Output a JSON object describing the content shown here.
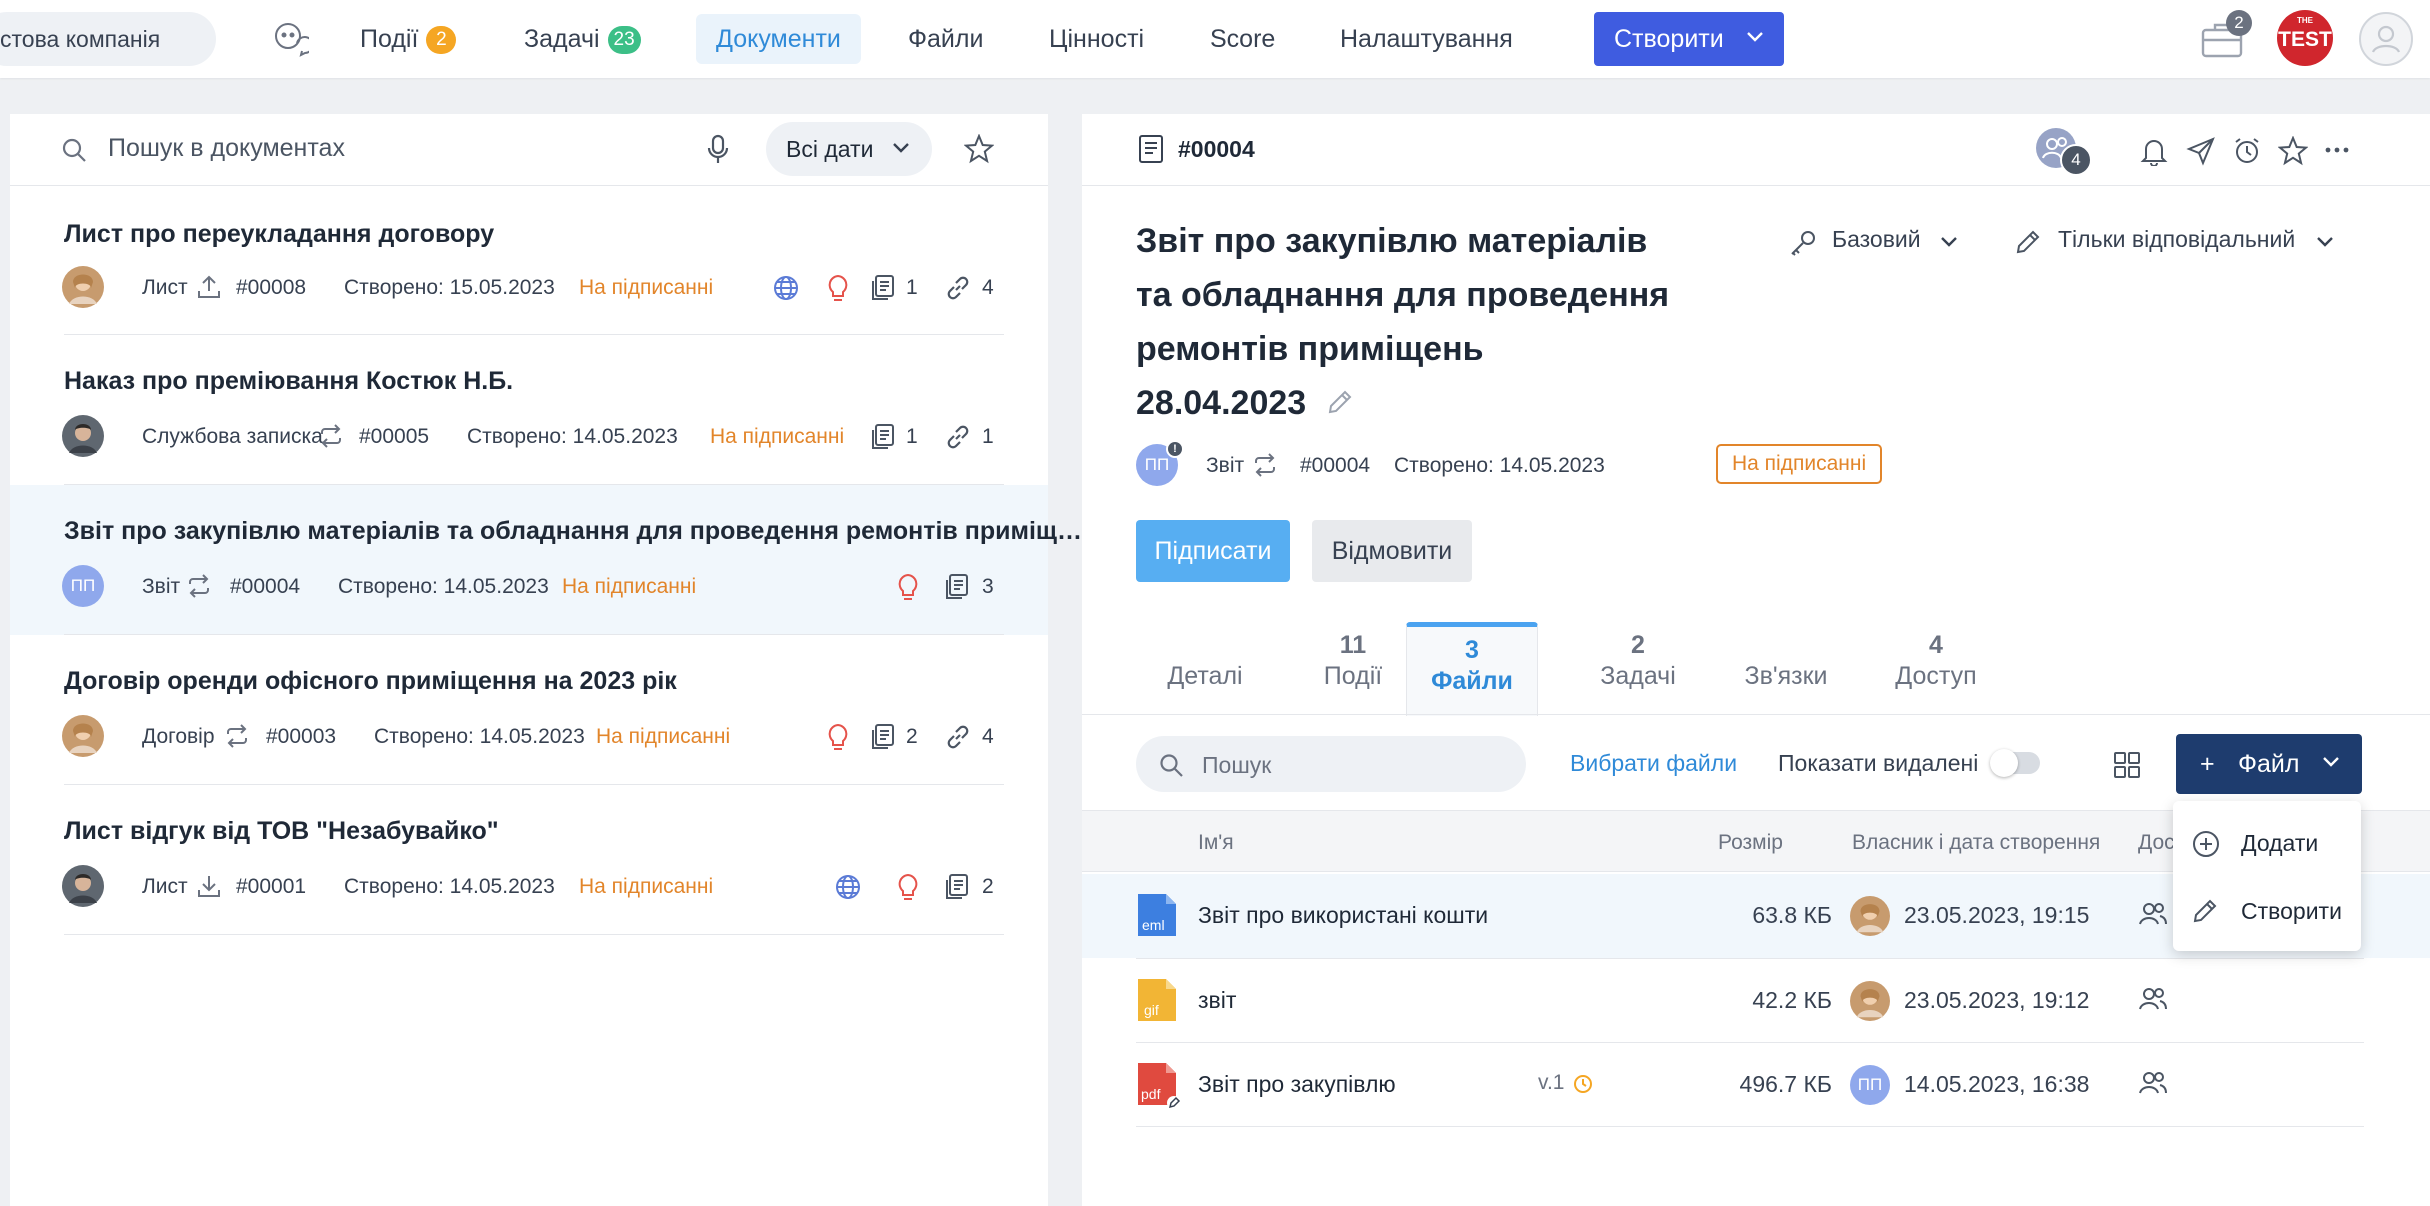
{
  "topbar": {
    "company": "стова компанія",
    "nav": [
      {
        "label": "Події",
        "badge": "2"
      },
      {
        "label": "Задачі",
        "badge": "23"
      },
      {
        "label": "Документи"
      },
      {
        "label": "Файли"
      },
      {
        "label": "Цінності"
      },
      {
        "label": "Score"
      },
      {
        "label": "Налаштування"
      }
    ],
    "create_label": "Створити",
    "briefcase_badge": "2",
    "logo_top": "THE",
    "logo_text": "TEST"
  },
  "left": {
    "search_placeholder": "Пошук в документах",
    "dates_label": "Всі дати",
    "documents": [
      {
        "title": "Лист про переукладання договору",
        "type": "Лист",
        "number": "#00008",
        "created": "Створено: 15.05.2023",
        "status": "На підписанні",
        "files": "1",
        "links": "4"
      },
      {
        "title": "Наказ про преміювання Костюк Н.Б.",
        "type": "Службова записка",
        "number": "#00005",
        "created": "Створено: 14.05.2023",
        "status": "На підписанні",
        "files": "1",
        "links": "1"
      },
      {
        "title": "Звіт про закупівлю матеріалів та обладнання для проведення ремонтів приміщ…",
        "avatar": "ПП",
        "type": "Звіт",
        "number": "#00004",
        "created": "Створено: 14.05.2023",
        "status": "На підписанні",
        "files": "3"
      },
      {
        "title": "Договір оренди офісного приміщення на 2023 рік",
        "type": "Договір",
        "number": "#00003",
        "created": "Створено: 14.05.2023",
        "status": "На підписанні",
        "files": "2",
        "links": "4"
      },
      {
        "title": "Лист відгук від ТОВ \"Незабувайко\"",
        "type": "Лист",
        "number": "#00001",
        "created": "Створено: 14.05.2023",
        "status": "На підписанні",
        "files": "2"
      }
    ]
  },
  "right": {
    "doc_number": "#00004",
    "members_count": "4",
    "title_lines": [
      "Звіт про закупівлю матеріалів",
      "та обладнання для проведення",
      "ремонтів приміщень",
      "28.04.2023"
    ],
    "access_level": "Базовий",
    "edit_rights": "Тільки відповідальний",
    "avatar": "ПП",
    "type": "Звіт",
    "number": "#00004",
    "created": "Створено: 14.05.2023",
    "status": "На підписанні",
    "sign_label": "Підписати",
    "reject_label": "Відмовити",
    "tabs": [
      {
        "count": "",
        "label": "Деталі"
      },
      {
        "count": "11",
        "label": "Події"
      },
      {
        "count": "3",
        "label": "Файли"
      },
      {
        "count": "2",
        "label": "Задачі"
      },
      {
        "count": "",
        "label": "Зв'язки"
      },
      {
        "count": "4",
        "label": "Доступ"
      }
    ],
    "files_search_placeholder": "Пошук",
    "choose_files": "Вибрати файли",
    "show_deleted": "Показати видалені",
    "file_button": "Файл",
    "columns": {
      "name": "Ім'я",
      "size": "Розмір",
      "owner": "Власник і дата створення",
      "access": "Дос"
    },
    "files": [
      {
        "ext": "eml",
        "name": "Звіт про використані кошти",
        "size": "63.8 КБ",
        "date": "23.05.2023, 19:15"
      },
      {
        "ext": "gif",
        "name": "звіт",
        "size": "42.2 КБ",
        "date": "23.05.2023, 19:12"
      },
      {
        "ext": "pdf",
        "name": "Звіт про закупівлю",
        "version": "v.1",
        "size": "496.7 КБ",
        "owner": "ПП",
        "date": "14.05.2023, 16:38"
      }
    ],
    "menu": [
      {
        "label": "Додати"
      },
      {
        "label": "Створити"
      }
    ]
  },
  "colors": {
    "accent": "#3f5ce0",
    "link": "#2f8ad8",
    "status": "#e2852a",
    "dark_button": "#1e3c6e",
    "sign_button": "#57aef2"
  }
}
